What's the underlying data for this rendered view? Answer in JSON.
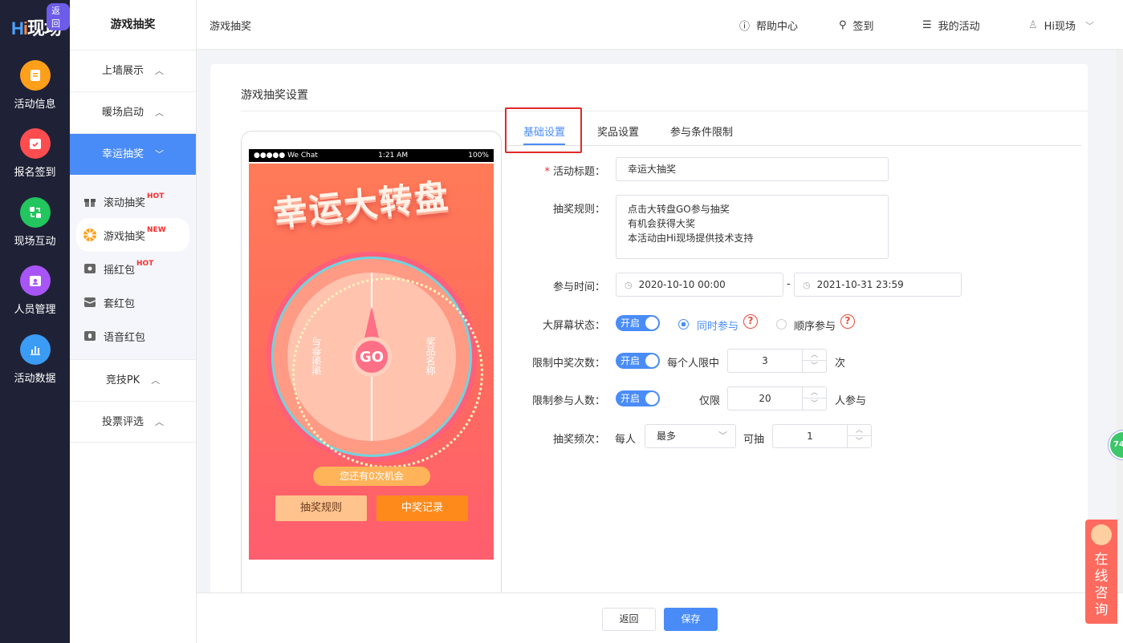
{
  "brand": {
    "logo_text": "Hi现场",
    "back_badge": "返回"
  },
  "rail": [
    {
      "label": "活动信息",
      "icon": "document-icon",
      "color": "#ff9f1a"
    },
    {
      "label": "报名签到",
      "icon": "calendar-check-icon",
      "color": "#ff4d4f"
    },
    {
      "label": "现场互动",
      "icon": "interaction-icon",
      "color": "#22c55e"
    },
    {
      "label": "人员管理",
      "icon": "people-icon",
      "color": "#a855f7"
    },
    {
      "label": "活动数据",
      "icon": "bar-chart-icon",
      "color": "#3b9cf5"
    }
  ],
  "menu": {
    "title": "游戏抽奖",
    "groups": [
      {
        "label": "上墙展示"
      },
      {
        "label": "暖场启动"
      },
      {
        "label": "幸运抽奖"
      },
      {
        "label": "竞技PK"
      },
      {
        "label": "投票评选"
      }
    ],
    "sub_items": [
      {
        "label": "滚动抽奖",
        "tag": "HOT",
        "icon": "gift-icon"
      },
      {
        "label": "游戏抽奖",
        "tag": "NEW",
        "icon": "wheel-icon"
      },
      {
        "label": "摇红包",
        "tag": "HOT",
        "icon": "shake-redpacket-icon"
      },
      {
        "label": "套红包",
        "tag": "",
        "icon": "cover-redpacket-icon"
      },
      {
        "label": "语音红包",
        "tag": "",
        "icon": "voice-redpacket-icon"
      }
    ]
  },
  "header": {
    "breadcrumb": "游戏抽奖",
    "help": "帮助中心",
    "checkin": "签到",
    "my_activities": "我的活动",
    "user": "Hi现场"
  },
  "card": {
    "title": "游戏抽奖设置"
  },
  "preview": {
    "status_left": "●●●●● We Chat",
    "status_time": "1:21 AM",
    "status_right": "100%",
    "title": "幸运大转盘",
    "go": "GO",
    "prize_left": "谢谢参与",
    "prize_right": "奖品名称",
    "chance": "您还有0次机会",
    "rules_btn": "抽奖规则",
    "records_btn": "中奖记录"
  },
  "tabs": [
    "基础设置",
    "奖品设置",
    "参与条件限制"
  ],
  "form": {
    "title_label": "活动标题：",
    "title_value": "幸运大抽奖",
    "rules_label": "抽奖规则：",
    "rules_lines": [
      "点击大转盘GO参与抽奖",
      "有机会获得大奖",
      "本活动由Hi现场提供技术支持"
    ],
    "time_label": "参与时间：",
    "time_start": "2020-10-10 00:00",
    "time_sep": "-",
    "time_end": "2021-10-31 23:59",
    "screen_label": "大屏幕状态：",
    "switch_on": "开启",
    "opt_simul": "同时参与",
    "opt_seq": "顺序参与",
    "limit_win_label": "限制中奖次数：",
    "limit_win_prefix": "每个人限中",
    "limit_win_value": "3",
    "limit_win_suffix": "次",
    "limit_people_label": "限制参与人数：",
    "limit_people_prefix": "仅限",
    "limit_people_value": "20",
    "limit_people_suffix": "人参与",
    "freq_label": "抽奖频次：",
    "freq_prefix": "每人",
    "freq_select": "最多",
    "freq_mid": "可抽",
    "freq_value": "1"
  },
  "footer": {
    "back": "返回",
    "save": "保存"
  },
  "float": {
    "consult": "在线咨询",
    "bubble": "74"
  }
}
